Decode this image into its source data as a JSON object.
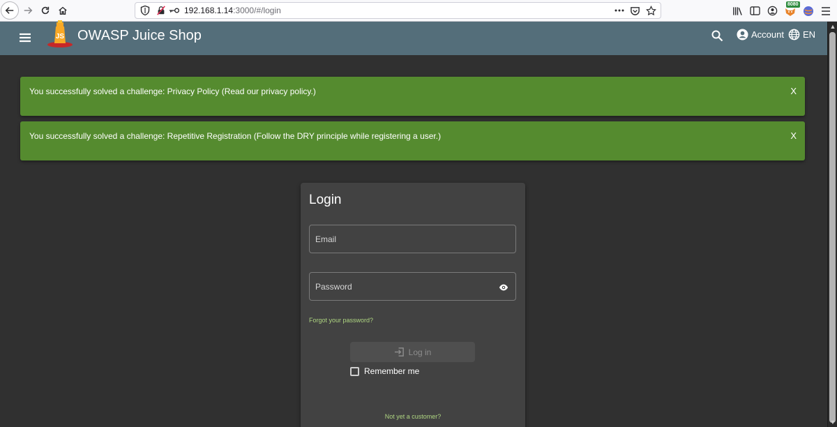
{
  "browser": {
    "url_host": "192.168.1.14",
    "url_rest": ":3000/#/login",
    "ext_badge": "8080"
  },
  "app": {
    "title": "OWASP Juice Shop",
    "account_label": "Account",
    "language_label": "EN",
    "toolbar_color": "#546e7a"
  },
  "notifications": [
    {
      "message": "You successfully solved a challenge: Privacy Policy (Read our privacy policy.)",
      "close_label": "X"
    },
    {
      "message": "You successfully solved a challenge: Repetitive Registration (Follow the DRY principle while registering a user.)",
      "close_label": "X"
    }
  ],
  "login": {
    "title": "Login",
    "email_placeholder": "Email",
    "password_placeholder": "Password",
    "forgot_password": "Forgot your password?",
    "login_button": "Log in",
    "remember_me": "Remember me",
    "not_customer": "Not yet a customer?",
    "accent_color": "#aed581",
    "success_color": "#558b2f"
  }
}
